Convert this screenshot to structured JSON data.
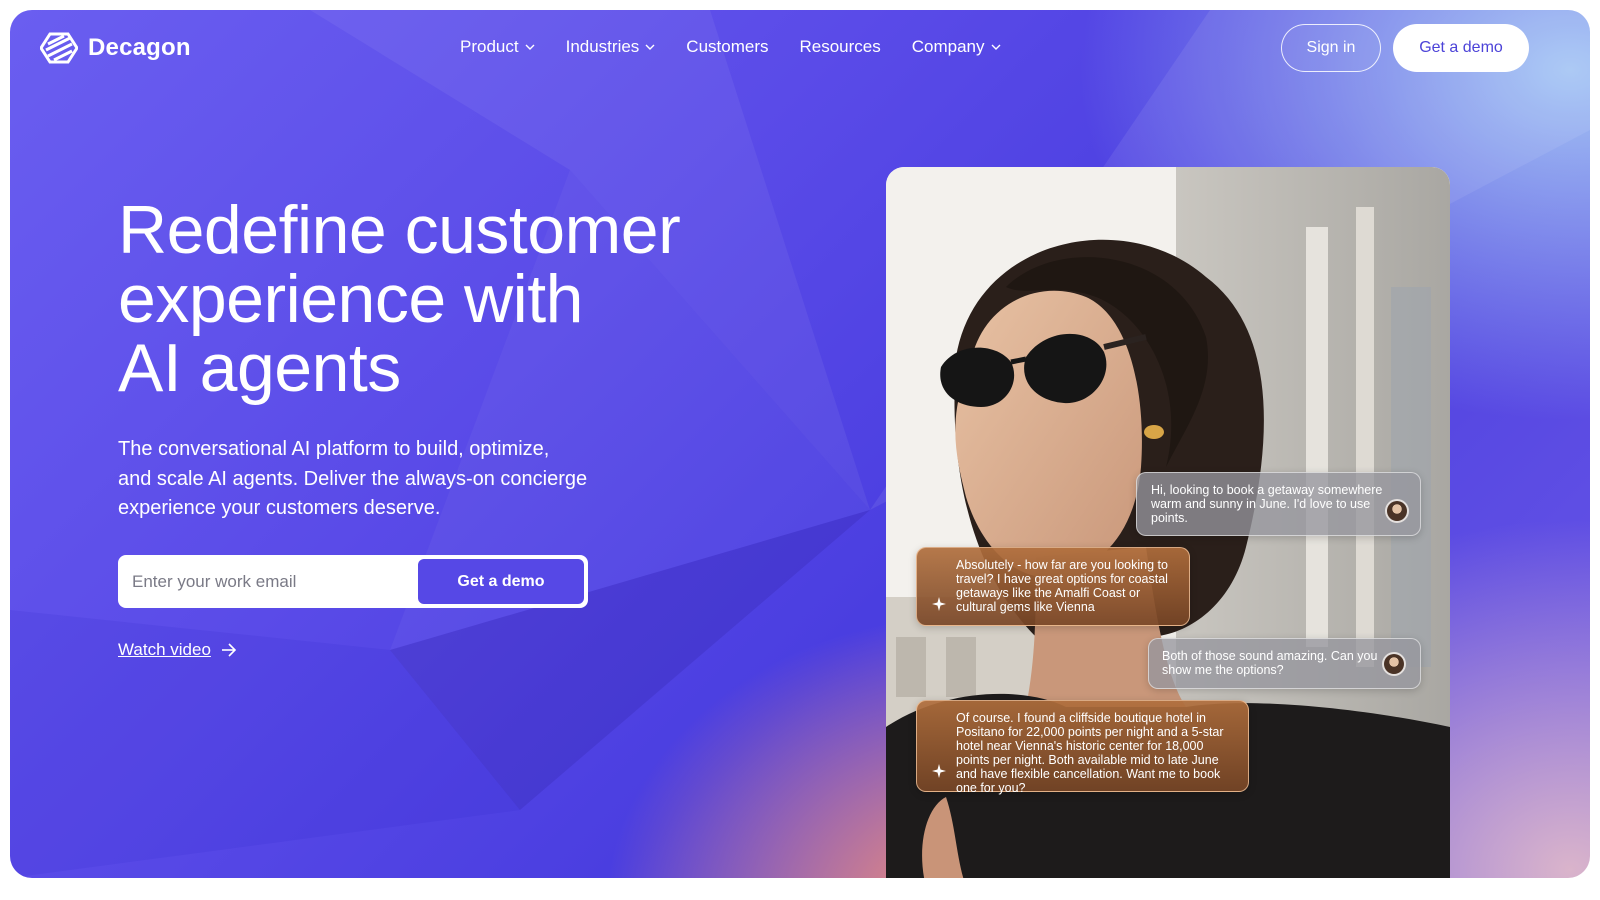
{
  "brand": {
    "name": "Decagon"
  },
  "nav": {
    "items": [
      {
        "label": "Product",
        "dropdown": true
      },
      {
        "label": "Industries",
        "dropdown": true
      },
      {
        "label": "Customers",
        "dropdown": false
      },
      {
        "label": "Resources",
        "dropdown": false
      },
      {
        "label": "Company",
        "dropdown": true
      }
    ],
    "sign_in": "Sign in",
    "get_demo": "Get a demo"
  },
  "hero": {
    "headline_lines": [
      "Redefine customer",
      "experience with",
      "AI agents"
    ],
    "subheading": "The conversational AI platform to build, optimize, and scale AI agents. Deliver the always-on concierge experience your customers deserve.",
    "email_placeholder": "Enter your work email",
    "email_button": "Get a demo",
    "watch_video": "Watch video"
  },
  "chat": {
    "messages": [
      {
        "from": "user",
        "text": "Hi, looking to book a getaway somewhere warm and sunny in June. I'd love to use points."
      },
      {
        "from": "agent",
        "text": "Absolutely - how far are you looking to travel? I have great options for coastal getaways like the Amalfi Coast or cultural gems like Vienna"
      },
      {
        "from": "user",
        "text": "Both of those sound amazing. Can you show me the options?"
      },
      {
        "from": "agent",
        "text": "Of course. I found a cliffside boutique hotel in Positano for 22,000 points per night and a 5-star hotel near Vienna's historic center for 18,000 points per night. Both available mid to late June and have flexible cancellation. Want me to book one for you?"
      }
    ]
  },
  "colors": {
    "primary": "#5648e6",
    "brand_text": "#4c43d8",
    "agent_bubble": "#a8683a"
  },
  "icons": {
    "logo": "decagon-logo-icon",
    "chevron": "chevron-down-icon",
    "arrow": "arrow-right-icon",
    "sparkle": "sparkle-icon"
  }
}
